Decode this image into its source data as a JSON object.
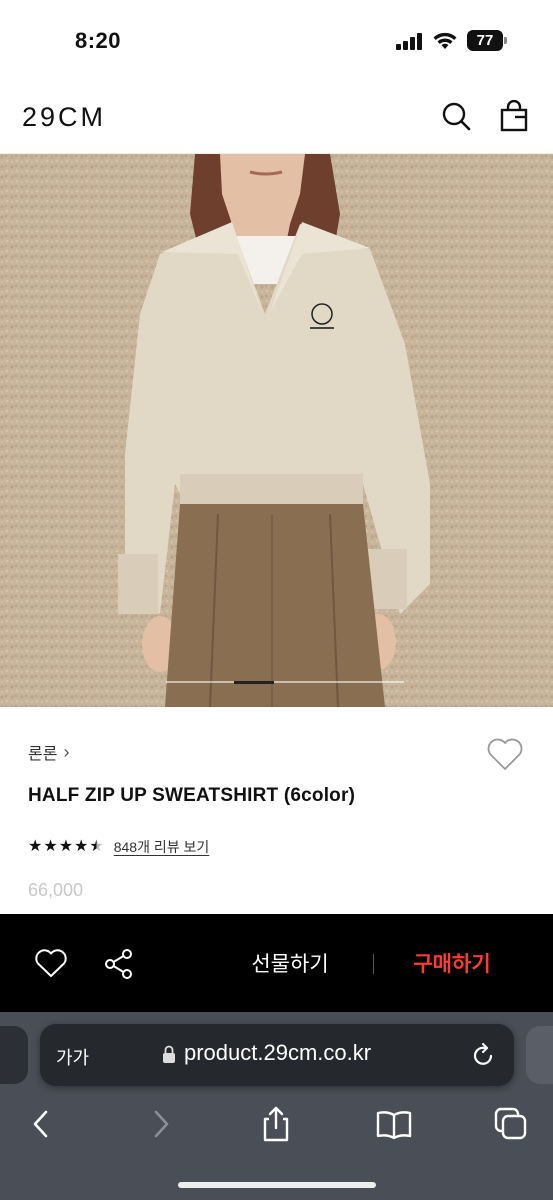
{
  "status_bar": {
    "time": "8:20",
    "battery_level": "77"
  },
  "header": {
    "logo": "29CM",
    "icons": [
      "search-icon",
      "shopping-bag-icon"
    ]
  },
  "product": {
    "brand": "론론",
    "brand_chevron": "›",
    "name": "HALF ZIP UP SWEATSHIRT (6color)",
    "rating": 4.5,
    "review_link": "848개 리뷰 보기",
    "price": "66,000",
    "image_colors": {
      "wall": "#c9b59c",
      "sweatshirt": "#e3d9c8",
      "trousers": "#8a6e52"
    }
  },
  "action_bar": {
    "gift_label": "선물하기",
    "buy_label": "구매하기",
    "buy_color": "#ff3b30"
  },
  "browser": {
    "aa_label": "가가",
    "url": "product.29cm.co.kr"
  }
}
